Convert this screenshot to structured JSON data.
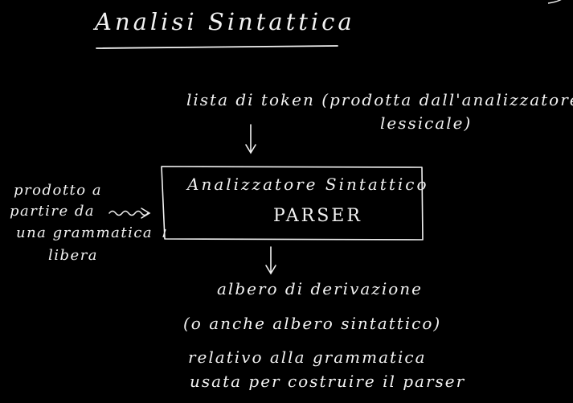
{
  "title": "Analisi Sintattica",
  "input": {
    "line1": "lista di token (prodotta dall'analizzatore",
    "line2": "lessicale)"
  },
  "box": {
    "line1": "Analizzatore Sintattico",
    "line2": "PARSER"
  },
  "side_note": {
    "line1": "prodotto a",
    "line2": "partire da",
    "line3": "una grammatica",
    "line4": "libera"
  },
  "output": {
    "line1": "albero di derivazione",
    "line2": "(o anche albero sintattico)",
    "line3": "relativo alla grammatica",
    "line4": "usata per costruire il parser"
  },
  "colors": {
    "background": "#000000",
    "ink": "#f2f2f2"
  }
}
